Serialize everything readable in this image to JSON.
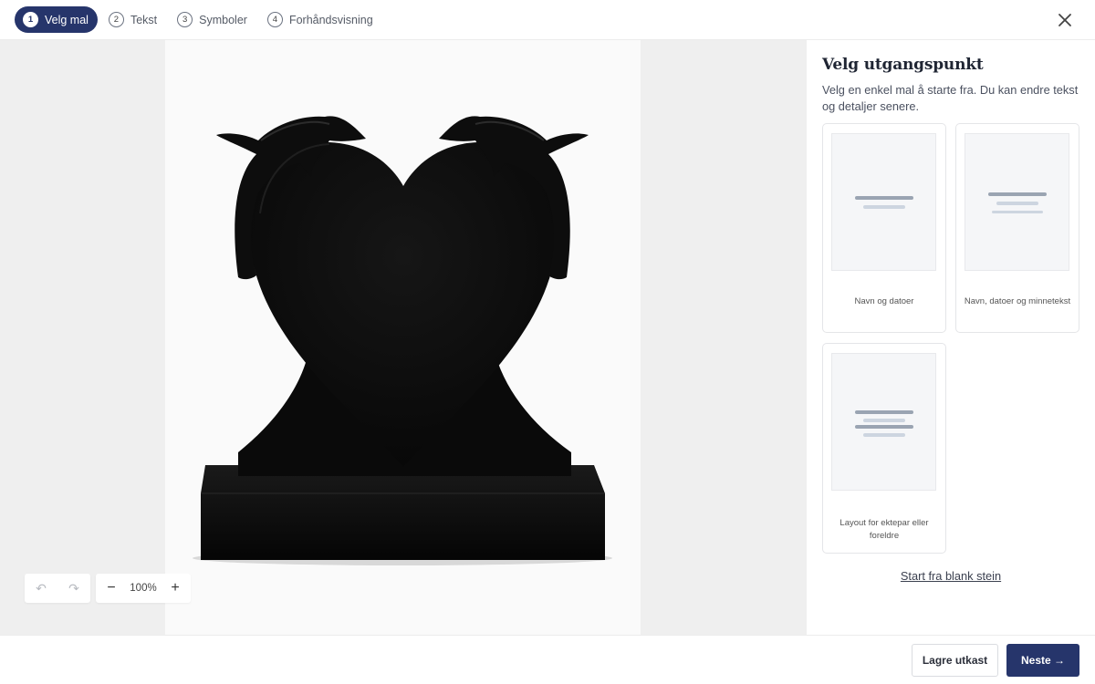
{
  "steps": [
    {
      "num": "1",
      "label": "Velg mal",
      "active": true
    },
    {
      "num": "2",
      "label": "Tekst",
      "active": false
    },
    {
      "num": "3",
      "label": "Symboler",
      "active": false
    },
    {
      "num": "4",
      "label": "Forhåndsvisning",
      "active": false
    }
  ],
  "toolbar": {
    "undo_icon": "↶",
    "redo_icon": "↷",
    "zoom_out": "−",
    "zoom_level": "100%",
    "zoom_in": "+"
  },
  "panel": {
    "title": "Velg utgangspunkt",
    "description": "Velg en enkel mal å starte fra. Du kan endre tekst og detaljer senere.",
    "templates": [
      {
        "label": "Navn og datoer"
      },
      {
        "label": "Navn, datoer og minnetekst"
      },
      {
        "label": "Layout for ektepar eller foreldre"
      }
    ],
    "blank_link": "Start fra blank stein"
  },
  "footer": {
    "save_label": "Lagre utkast",
    "next_label": "Neste →"
  },
  "colors": {
    "accent": "#26356b",
    "canvas_bg": "#efefef",
    "stone": "#0c0c0c"
  }
}
